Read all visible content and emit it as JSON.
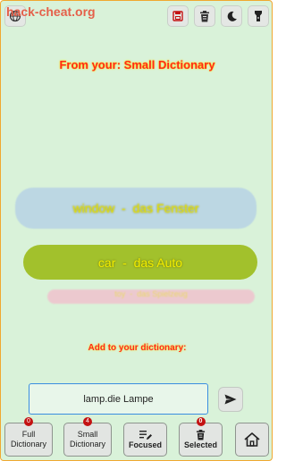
{
  "watermark": "hack-cheat.org",
  "header": {
    "title": "From your: Small Dictionary"
  },
  "cards": [
    {
      "word": "window",
      "sep": "-",
      "translation": "das Fenster"
    },
    {
      "word": "car",
      "sep": "-",
      "translation": "das Auto"
    },
    {
      "word": "toy",
      "sep": "-",
      "translation": "das Spielzeug"
    }
  ],
  "add_section": {
    "label": "Add to your dictionary:",
    "input_value": "lamp.die Lampe"
  },
  "nav": {
    "full_dictionary": {
      "label": "Full\nDictionary",
      "badge": "0"
    },
    "small_dictionary": {
      "label": "Small\nDictionary",
      "badge": "4"
    },
    "focused": {
      "label": "Focused"
    },
    "selected": {
      "label": "Selected",
      "badge": "0"
    }
  },
  "colors": {
    "background": "#d9f2d9",
    "title_red": "#ff2a1a",
    "title_glow": "#ffe000",
    "card_blue": "#bcd7e3",
    "card_green": "#a2c12c",
    "card_pink": "#ecc9cf",
    "badge_red": "#c41212",
    "input_border": "#3a8ee0"
  },
  "icons": [
    "globe-icon",
    "save-icon",
    "trash-icon",
    "moon-icon",
    "flashlight-icon",
    "send-icon",
    "edit-list-icon",
    "trash-icon",
    "home-icon"
  ]
}
